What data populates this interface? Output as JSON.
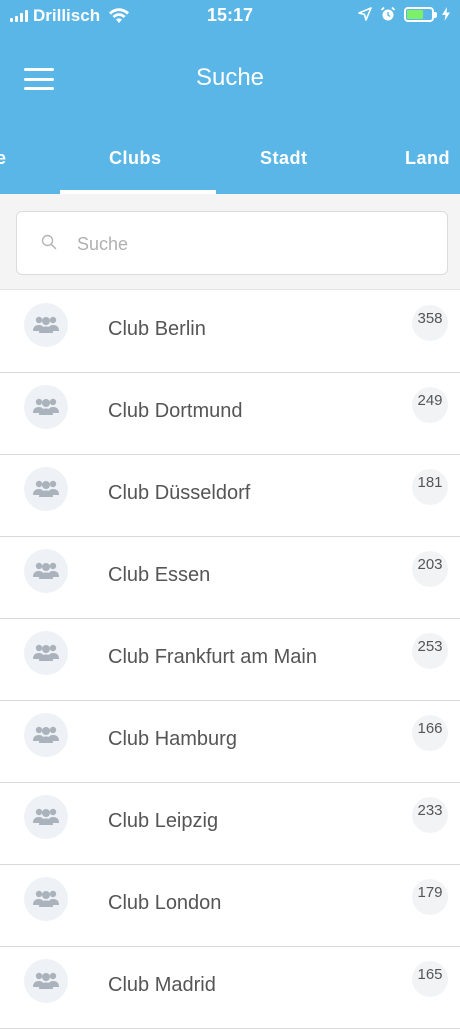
{
  "status_bar": {
    "carrier": "Drillisch",
    "time": "15:17",
    "icons": [
      "signal-icon",
      "wifi-icon",
      "location-arrow-icon",
      "alarm-icon",
      "battery-icon",
      "charging-icon"
    ]
  },
  "header": {
    "title": "Suche",
    "menu_icon": "hamburger-menu-icon"
  },
  "tabs": [
    {
      "label": "e",
      "active": false
    },
    {
      "label": "Clubs",
      "active": true
    },
    {
      "label": "Stadt",
      "active": false
    },
    {
      "label": "Land",
      "active": false
    }
  ],
  "search": {
    "placeholder": "Suche",
    "value": ""
  },
  "clubs": [
    {
      "name": "Club Berlin",
      "count": "358"
    },
    {
      "name": "Club Dortmund",
      "count": "249"
    },
    {
      "name": "Club Düsseldorf",
      "count": "181"
    },
    {
      "name": "Club Essen",
      "count": "203"
    },
    {
      "name": "Club Frankfurt am Main",
      "count": "253"
    },
    {
      "name": "Club Hamburg",
      "count": "166"
    },
    {
      "name": "Club Leipzig",
      "count": "233"
    },
    {
      "name": "Club London",
      "count": "179"
    },
    {
      "name": "Club Madrid",
      "count": "165"
    }
  ],
  "colors": {
    "accent": "#5ab6e6",
    "battery_fill": "#7df06a",
    "row_text": "#555555"
  }
}
